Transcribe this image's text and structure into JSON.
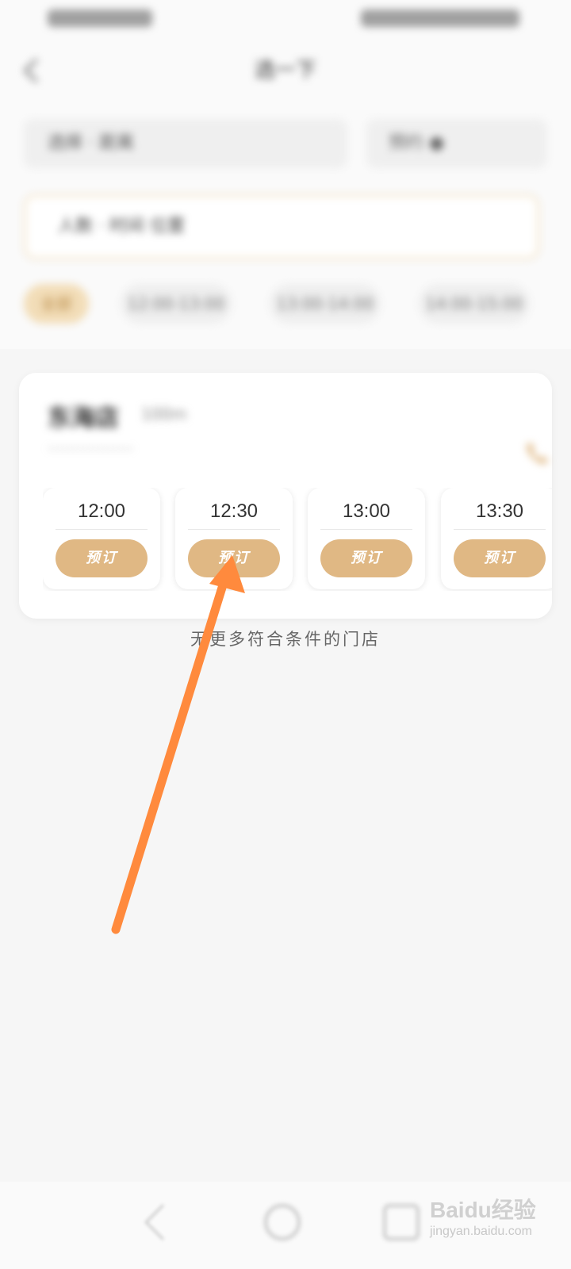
{
  "header": {
    "title": "选一下"
  },
  "filters": {
    "primary": "选择  ·  距离",
    "toggle": "预约 ●"
  },
  "info": {
    "text": "人数 ·  时间  位置"
  },
  "chips": [
    "全部",
    "12:00-13:00",
    "13:00-14:00",
    "14:00-15:00"
  ],
  "store": {
    "name": "东海店",
    "distance": "100m",
    "address": "·················"
  },
  "slots": [
    {
      "time": "12:00",
      "button": "预订"
    },
    {
      "time": "12:30",
      "button": "预订"
    },
    {
      "time": "13:00",
      "button": "预订"
    },
    {
      "time": "13:30",
      "button": "预订"
    }
  ],
  "footer": {
    "end_text": "无更多符合条件的门店"
  },
  "watermark": {
    "brand": "Baidu经验",
    "url": "jingyan.baidu.com"
  },
  "colors": {
    "accent": "#e0b884",
    "annotation_arrow": "#ff8a3d",
    "background": "#f6f6f6"
  }
}
